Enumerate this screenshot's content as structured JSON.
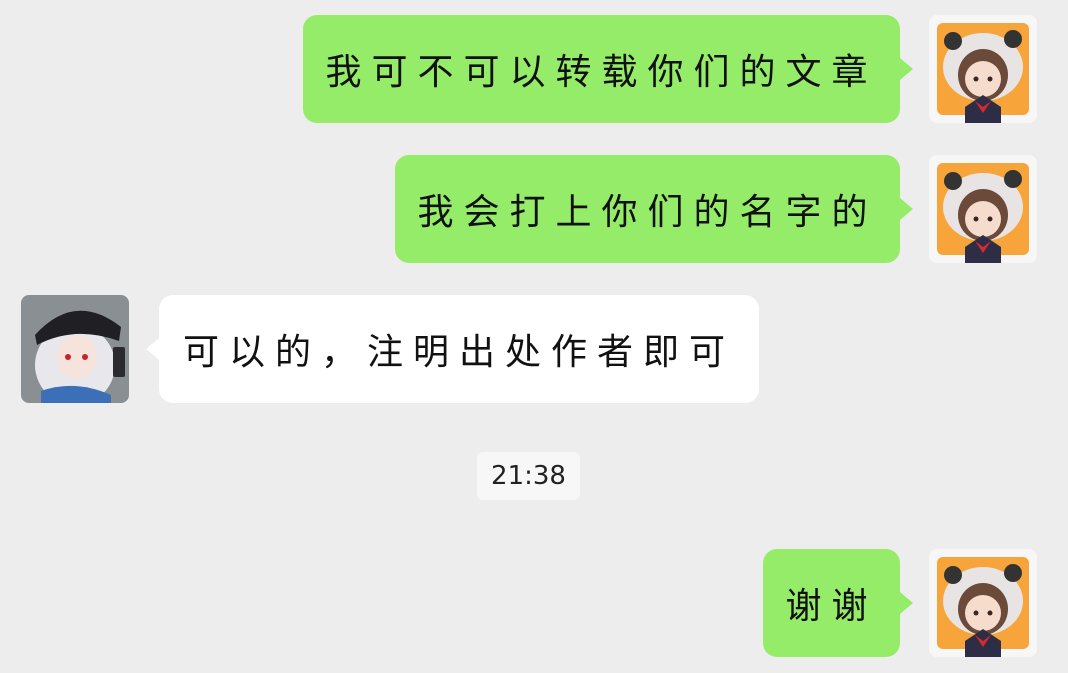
{
  "messages": [
    {
      "direction": "outgoing",
      "text": "我可不可以转载你们的文章"
    },
    {
      "direction": "outgoing",
      "text": "我会打上你们的名字的"
    },
    {
      "direction": "incoming",
      "text": "可以的，注明出处作者即可"
    },
    {
      "direction": "outgoing",
      "text": "谢谢"
    }
  ],
  "timestamp": "21:38",
  "colors": {
    "background": "#ededed",
    "outgoing_bubble": "#95ec69",
    "incoming_bubble": "#ffffff"
  },
  "icons": {
    "self_avatar": "anime-girl-panda-hood-avatar",
    "other_avatar": "anime-girl-white-hair-black-hat-avatar"
  }
}
